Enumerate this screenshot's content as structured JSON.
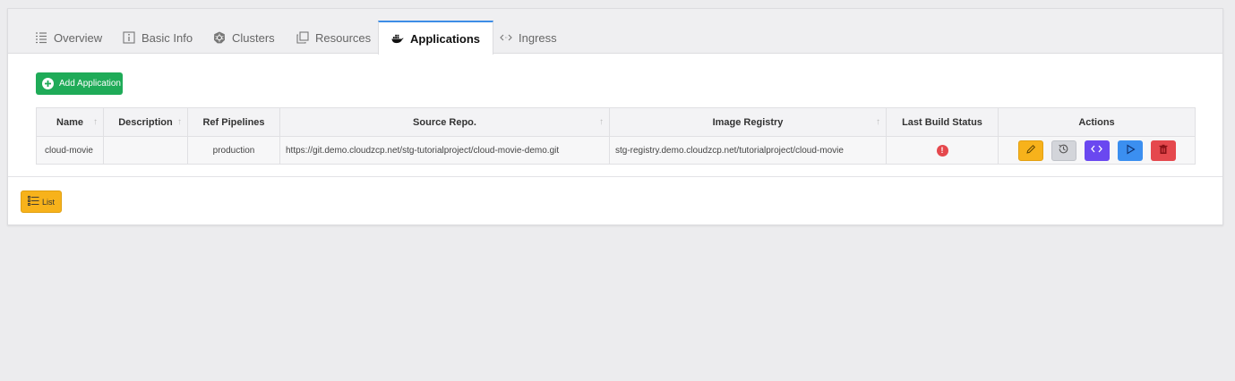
{
  "tabs": [
    {
      "label": "Overview",
      "icon": "list-icon"
    },
    {
      "label": "Basic Info",
      "icon": "info-icon"
    },
    {
      "label": "Clusters",
      "icon": "kubernetes-icon"
    },
    {
      "label": "Resources",
      "icon": "copy-icon"
    },
    {
      "label": "Applications",
      "icon": "docker-icon"
    },
    {
      "label": "Ingress",
      "icon": "code-icon"
    }
  ],
  "active_tab": "Applications",
  "add_button": {
    "label": "Add Application",
    "color": "#1fab58"
  },
  "table": {
    "columns": [
      "Name",
      "Description",
      "Ref Pipelines",
      "Source Repo.",
      "Image Registry",
      "Last Build Status",
      "Actions"
    ],
    "rows": [
      {
        "name": "cloud-movie",
        "description": "",
        "ref_pipelines": "production",
        "source_repo": "https://git.demo.cloudzcp.net/stg-tutorialproject/cloud-movie-demo.git",
        "image_registry": "stg-registry.demo.cloudzcp.net/tutorialproject/cloud-movie",
        "last_build_status": "error"
      }
    ],
    "actions": [
      {
        "name": "edit",
        "icon": "pencil-icon",
        "color": "#f7b21b"
      },
      {
        "name": "history",
        "icon": "history-icon",
        "color": "#d3d5da"
      },
      {
        "name": "code",
        "icon": "code-icon",
        "color": "#6a48f0"
      },
      {
        "name": "run",
        "icon": "play-icon",
        "color": "#3b8ff0"
      },
      {
        "name": "delete",
        "icon": "trash-icon",
        "color": "#e5484d"
      }
    ]
  },
  "list_button": {
    "label": "List",
    "color": "#f7b21b"
  }
}
